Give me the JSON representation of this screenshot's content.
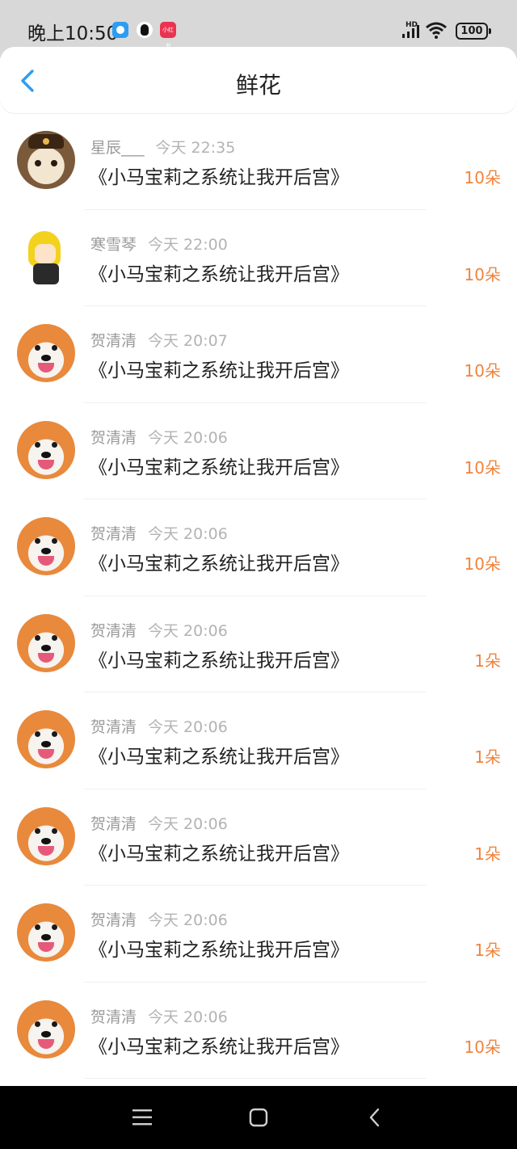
{
  "status_bar": {
    "time": "晚上10:50",
    "app_icons": [
      "message-app-icon",
      "qq-icon",
      "xiaohongshu-icon"
    ],
    "small_app_label": "小红书",
    "network": "HD",
    "battery": "100"
  },
  "header": {
    "title": "鲜花",
    "back_icon": "chevron-left-icon"
  },
  "colors": {
    "accent_blue": "#2b9df3",
    "amount_orange": "#f0843c"
  },
  "records": [
    {
      "user": "星辰___",
      "time": "今天 22:35",
      "book": "《小马宝莉之系统让我开后宫》",
      "amount": "10朵",
      "avatar": "cat"
    },
    {
      "user": "寒雪琴",
      "time": "今天 22:00",
      "book": "《小马宝莉之系统让我开后宫》",
      "amount": "10朵",
      "avatar": "anime"
    },
    {
      "user": "贺清清",
      "time": "今天 20:07",
      "book": "《小马宝莉之系统让我开后宫》",
      "amount": "10朵",
      "avatar": "dog"
    },
    {
      "user": "贺清清",
      "time": "今天 20:06",
      "book": "《小马宝莉之系统让我开后宫》",
      "amount": "10朵",
      "avatar": "dog"
    },
    {
      "user": "贺清清",
      "time": "今天 20:06",
      "book": "《小马宝莉之系统让我开后宫》",
      "amount": "10朵",
      "avatar": "dog"
    },
    {
      "user": "贺清清",
      "time": "今天 20:06",
      "book": "《小马宝莉之系统让我开后宫》",
      "amount": "1朵",
      "avatar": "dog"
    },
    {
      "user": "贺清清",
      "time": "今天 20:06",
      "book": "《小马宝莉之系统让我开后宫》",
      "amount": "1朵",
      "avatar": "dog"
    },
    {
      "user": "贺清清",
      "time": "今天 20:06",
      "book": "《小马宝莉之系统让我开后宫》",
      "amount": "1朵",
      "avatar": "dog"
    },
    {
      "user": "贺清清",
      "time": "今天 20:06",
      "book": "《小马宝莉之系统让我开后宫》",
      "amount": "1朵",
      "avatar": "dog"
    },
    {
      "user": "贺清清",
      "time": "今天 20:06",
      "book": "《小马宝莉之系统让我开后宫》",
      "amount": "10朵",
      "avatar": "dog"
    }
  ],
  "nav_bar": {
    "buttons": [
      "menu-icon",
      "home-icon",
      "back-icon"
    ]
  }
}
